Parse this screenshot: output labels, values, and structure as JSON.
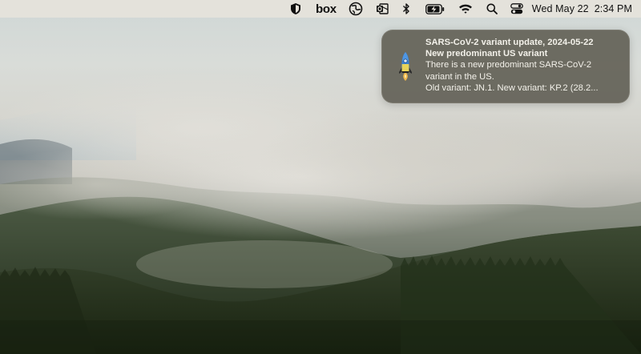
{
  "menubar": {
    "items": [
      {
        "name": "security-shield-icon"
      },
      {
        "name": "box-icon",
        "label": "box"
      },
      {
        "name": "globe-network-icon"
      },
      {
        "name": "outlook-icon"
      },
      {
        "name": "bluetooth-icon"
      },
      {
        "name": "battery-charging-icon"
      },
      {
        "name": "wifi-icon"
      },
      {
        "name": "search-icon"
      },
      {
        "name": "control-center-icon"
      }
    ],
    "date": "Wed May 22",
    "time": "2:34 PM"
  },
  "notification": {
    "app_icon": "rocket-icon",
    "title": "SARS-CoV-2 variant update, 2024-05-22",
    "subtitle": "New predominant US variant",
    "body_lines": [
      "There is a new predominant SARS-CoV-2",
      "variant in the US.",
      "Old variant: JN.1. New variant: KP.2 (28.2..."
    ]
  },
  "colors": {
    "menubar_bg": "#e8e4dc",
    "notification_bg": "#605e54",
    "notification_text": "#f3f1ea"
  }
}
